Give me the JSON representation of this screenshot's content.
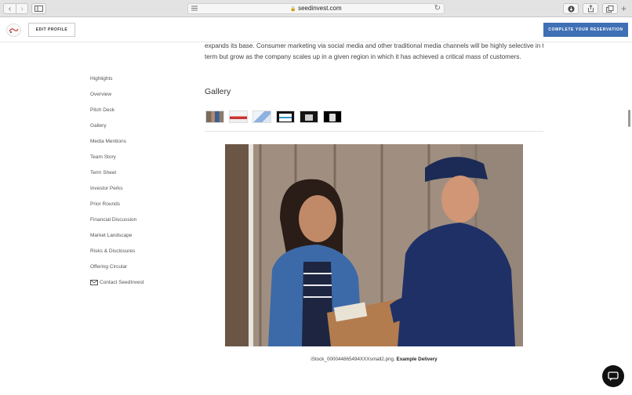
{
  "browser": {
    "url": "seedinvest.com",
    "back_icon": "chevron-left-icon",
    "forward_icon": "chevron-right-icon",
    "new_tab_symbol": "+"
  },
  "header": {
    "edit_profile": "EDIT PROFILE",
    "cta": "COMPLETE YOUR RESERVATION",
    "accent_color": "#3f6fb5"
  },
  "sidebar": {
    "items": [
      {
        "label": "Highlights"
      },
      {
        "label": "Overview"
      },
      {
        "label": "Pitch Deck"
      },
      {
        "label": "Gallery"
      },
      {
        "label": "Media Mentions"
      },
      {
        "label": "Team Story"
      },
      {
        "label": "Term Sheet"
      },
      {
        "label": "Investor Perks"
      },
      {
        "label": "Prior Rounds"
      },
      {
        "label": "Financial Discussion"
      },
      {
        "label": "Market Landscape"
      },
      {
        "label": "Risks & Disclosures"
      },
      {
        "label": "Offering Circular"
      }
    ],
    "contact": "Contact SeedInvest"
  },
  "main": {
    "paragraph_lines": [
      "expands its base. Consumer marketing via social media and other traditional media channels will be highly selective in the short",
      "term but grow as the company scales up in a given region in which it has achieved a critical mass of customers."
    ],
    "gallery_title": "Gallery",
    "caption_file": "iStock_000044865494XXXsmall2.png.",
    "caption_title": "Example Delivery"
  }
}
